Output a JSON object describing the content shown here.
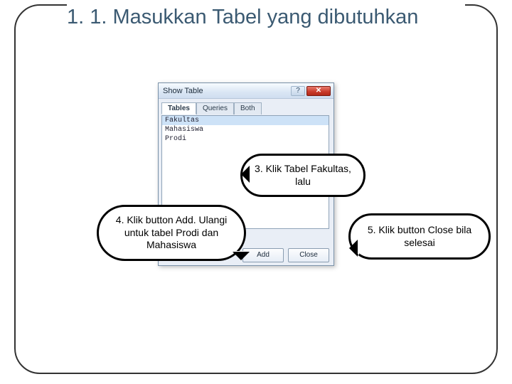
{
  "slide": {
    "title": "1. 1. Masukkan Tabel yang dibutuhkan"
  },
  "window": {
    "title": "Show Table",
    "help_symbol": "?",
    "close_symbol": "✕",
    "tabs": [
      {
        "label": "Tables",
        "active": true
      },
      {
        "label": "Queries",
        "active": false
      },
      {
        "label": "Both",
        "active": false
      }
    ],
    "list": [
      {
        "label": "Fakultas",
        "selected": true
      },
      {
        "label": "Mahasiswa",
        "selected": false
      },
      {
        "label": "Prodi",
        "selected": false
      }
    ],
    "buttons": {
      "add": "Add",
      "close": "Close"
    }
  },
  "callouts": {
    "c3": "3. Klik Tabel Fakultas, lalu",
    "c4": "4. Klik button Add. Ulangi untuk tabel Prodi dan Mahasiswa",
    "c5": "5. Klik button Close bila selesai"
  }
}
